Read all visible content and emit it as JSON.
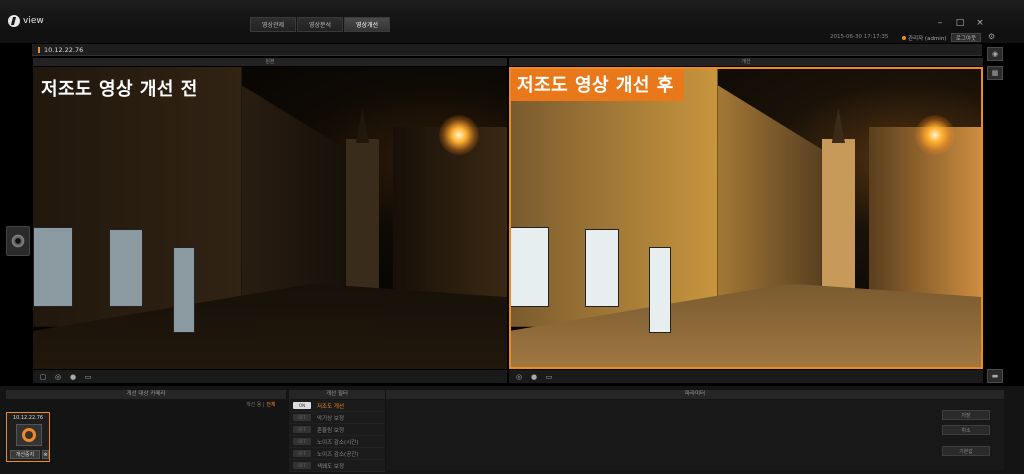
{
  "app": {
    "name": "view"
  },
  "menu": {
    "tabs": [
      {
        "label": "영상관제",
        "active": false
      },
      {
        "label": "영상분석",
        "active": false
      },
      {
        "label": "영상개선",
        "active": true
      }
    ]
  },
  "window": {
    "minimize": "–",
    "maximize": "□",
    "close": "×"
  },
  "status": {
    "datetime": "2015-06-30   17:17:35",
    "user": "관리자 (admin)",
    "logout": "로그아웃",
    "settings_icon": "gear-icon"
  },
  "camera_header": {
    "id": "10.12.22.76"
  },
  "viewer": {
    "left": {
      "header": "원본",
      "caption": "저조도 영상 개선 전"
    },
    "right": {
      "header": "개선",
      "caption": "저조도 영상 개선 후"
    }
  },
  "bottom": {
    "target_header": "개선 대상 카메라",
    "filter_header": "개선 필터",
    "param_header": "파라미터",
    "target_select": {
      "label": "개선 용",
      "separator": "|",
      "all": "전체"
    },
    "camera_card": {
      "id": "10.12.22.76",
      "start_button": "개선중지",
      "delete": "⊗"
    },
    "filters": [
      {
        "label": "저조도 개선",
        "on": true
      },
      {
        "label": "악기상 보정",
        "on": false
      },
      {
        "label": "흔들림 보정",
        "on": false
      },
      {
        "label": "노이즈 감소(시간)",
        "on": false
      },
      {
        "label": "노이즈 감소(공간)",
        "on": false
      },
      {
        "label": "색왜도 보정",
        "on": false
      }
    ],
    "toggle_on": "ON",
    "toggle_off": "OFF",
    "param_buttons": {
      "apply": "저장",
      "reset": "취소",
      "default": "기본값"
    }
  },
  "colors": {
    "accent": "#f08a24",
    "background": "#141414"
  }
}
